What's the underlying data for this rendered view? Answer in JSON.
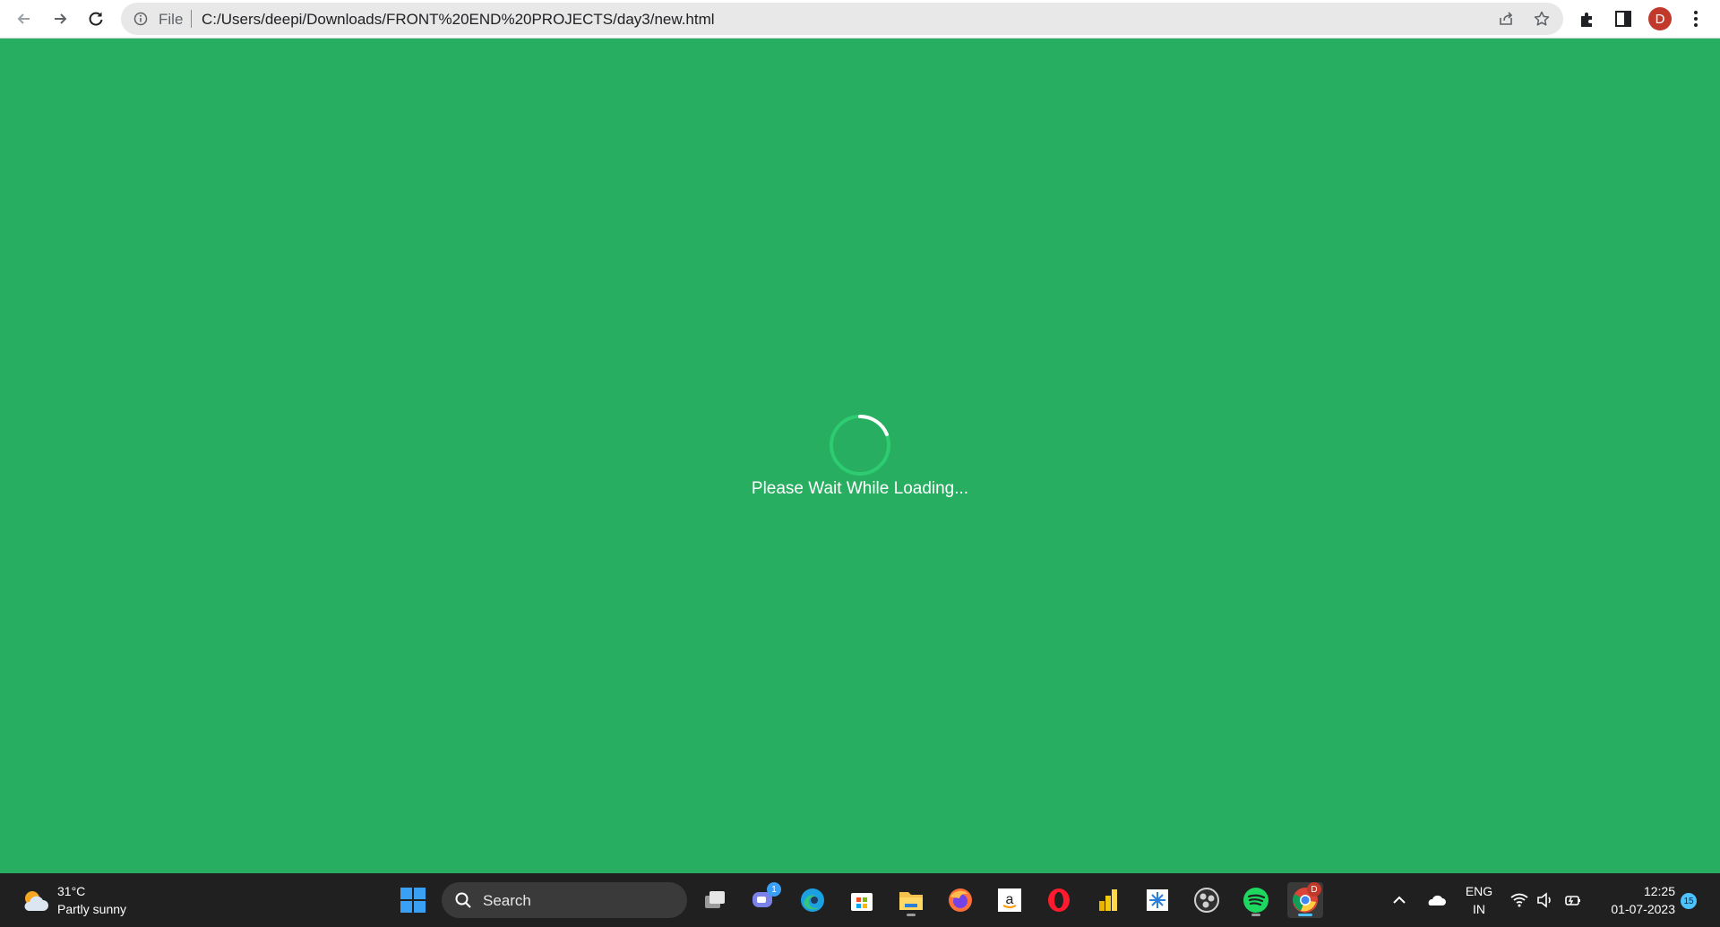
{
  "browser": {
    "scheme_label": "File",
    "url": "C:/Users/deepi/Downloads/FRONT%20END%20PROJECTS/day3/new.html",
    "profile_initial": "D",
    "icons": [
      "back-icon",
      "forward-icon",
      "reload-icon",
      "info-icon",
      "share-icon",
      "star-icon",
      "extensions-icon",
      "side-panel-icon",
      "menu-icon"
    ]
  },
  "page": {
    "background_color": "#27ae60",
    "loading_text": "Please Wait While Loading..."
  },
  "taskbar": {
    "weather": {
      "temperature": "31°C",
      "condition": "Partly sunny"
    },
    "search_label": "Search",
    "apps": [
      "start",
      "task-view",
      "teams",
      "edge",
      "store",
      "file-explorer",
      "firefox",
      "amazon",
      "opera",
      "power-bi",
      "snipping",
      "obs",
      "spotify",
      "chrome"
    ],
    "teams_badge": "1",
    "chrome_badge": "D",
    "language": {
      "line1": "ENG",
      "line2": "IN"
    },
    "clock": {
      "time": "12:25",
      "date": "01-07-2023"
    },
    "notification_count": "15"
  }
}
